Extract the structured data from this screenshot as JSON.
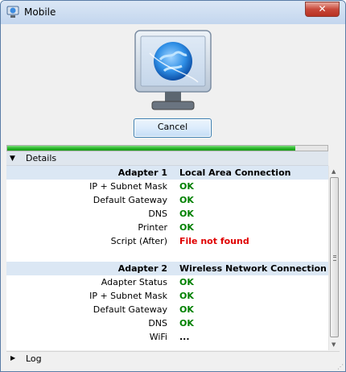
{
  "window": {
    "title": "Mobile",
    "close_symbol": "✕"
  },
  "cancel_button": {
    "label": "Cancel"
  },
  "progress": {
    "fraction": 0.9
  },
  "details": {
    "label": "Details",
    "expanded": true
  },
  "log": {
    "label": "Log",
    "expanded": false
  },
  "adapters": [
    {
      "header_label": "Adapter 1",
      "header_value": "Local Area Connection",
      "rows": [
        {
          "label": "IP + Subnet Mask",
          "value": "OK",
          "status": "ok"
        },
        {
          "label": "Default Gateway",
          "value": "OK",
          "status": "ok"
        },
        {
          "label": "DNS",
          "value": "OK",
          "status": "ok"
        },
        {
          "label": "Printer",
          "value": "OK",
          "status": "ok"
        },
        {
          "label": "Script (After)",
          "value": "File not found",
          "status": "error"
        }
      ]
    },
    {
      "header_label": "Adapter 2",
      "header_value": "Wireless Network Connection",
      "rows": [
        {
          "label": "Adapter Status",
          "value": "OK",
          "status": "ok"
        },
        {
          "label": "IP + Subnet Mask",
          "value": "OK",
          "status": "ok"
        },
        {
          "label": "Default Gateway",
          "value": "OK",
          "status": "ok"
        },
        {
          "label": "DNS",
          "value": "OK",
          "status": "ok"
        },
        {
          "label": "WiFi",
          "value": "...",
          "status": "pending"
        }
      ]
    }
  ],
  "colors": {
    "ok": "#008000",
    "error": "#e00000",
    "progress": "#22b022"
  }
}
